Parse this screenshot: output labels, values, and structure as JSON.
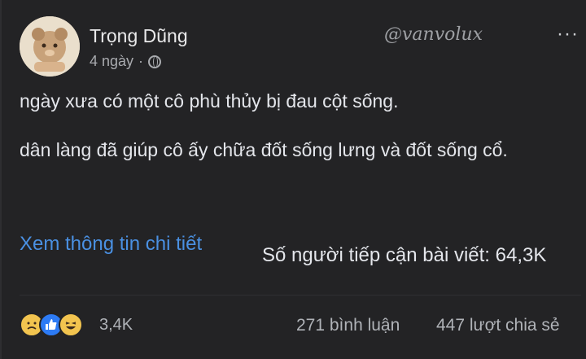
{
  "post": {
    "author": "Trọng Dũng",
    "time": "4 ngày",
    "separator": "·",
    "privacy_icon": "globe-icon",
    "watermark": "@vanvolux",
    "more_icon": "more-options-icon",
    "more_glyph": "···",
    "body_line1": "ngày xưa có một cô phù thủy bị đau cột sống.",
    "body_line2": "dân làng đã giúp cô ấy chữa đốt sống lưng và đốt sống cổ.",
    "see_more_label": "Xem thông tin chi tiết",
    "reach_label": "Số người tiếp cận bài viết: 64,3K"
  },
  "footer": {
    "reactions": [
      "sad-reaction-icon",
      "like-reaction-icon",
      "haha-reaction-icon"
    ],
    "reaction_count": "3,4K",
    "comments": "271 bình luận",
    "shares": "447 lượt chia sẻ"
  },
  "colors": {
    "background": "#232325",
    "link": "#4a90e2",
    "like": "#2d7bf5",
    "emoji": "#f2c44f"
  }
}
